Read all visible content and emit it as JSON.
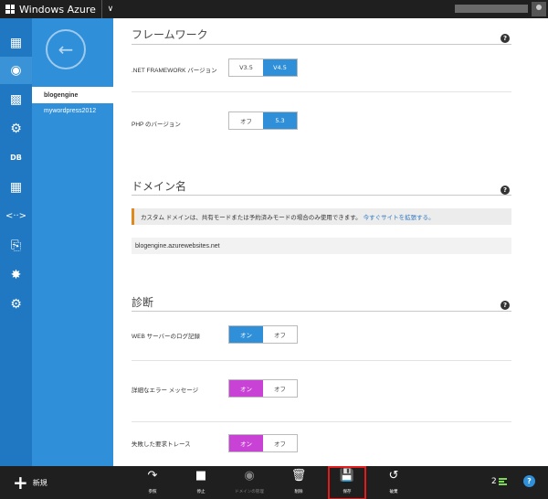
{
  "topbar": {
    "brand": "Windows Azure"
  },
  "rail": {
    "icons": [
      "grid-icon",
      "globe-icon",
      "monitor-icon",
      "cloud-service-icon",
      "database-icon",
      "table-icon",
      "code-icon",
      "mobile-icon",
      "network-icon",
      "gear-icon"
    ]
  },
  "sites": {
    "items": [
      {
        "label": "blogengine",
        "selected": true
      },
      {
        "label": "mywordpress2012",
        "selected": false
      }
    ]
  },
  "framework": {
    "title": "フレームワーク",
    "net_label": ".NET FRAMEWORK バージョン",
    "net_options": [
      "V3.5",
      "V4.5"
    ],
    "net_selected": "V4.5",
    "php_label": "PHP のバージョン",
    "php_options": [
      "オフ",
      "5.3"
    ],
    "php_selected": "5.3"
  },
  "domain": {
    "title": "ドメイン名",
    "notice": "カスタム ドメインは、共有モードまたは予約済みモードの場合のみ使用できます。",
    "notice_link": "今すぐサイトを拡張する。",
    "value": "blogengine.azurewebsites.net"
  },
  "diagnostics": {
    "title": "診断",
    "web_log_label": "WEB サーバーのログ記録",
    "web_log_options": [
      "オン",
      "オフ"
    ],
    "error_label": "詳細なエラー メッセージ",
    "error_options": [
      "オン",
      "オフ"
    ],
    "trace_label": "失敗した要求トレース",
    "trace_options": [
      "オン",
      "オフ"
    ]
  },
  "cmdbar": {
    "new_label": "新規",
    "commands": [
      {
        "label": "参照",
        "icon": "browse-icon"
      },
      {
        "label": "停止",
        "icon": "stop-icon"
      },
      {
        "label": "ドメインの管理",
        "icon": "domain-icon"
      },
      {
        "label": "削除",
        "icon": "trash-icon"
      },
      {
        "label": "保存",
        "icon": "save-icon"
      },
      {
        "label": "破棄",
        "icon": "undo-icon"
      }
    ],
    "count": "2"
  },
  "colors": {
    "accent": "#2f8fd9",
    "rail": "#1f78c1",
    "toggle_pink": "#c842d6",
    "highlight": "#e31b1b"
  }
}
